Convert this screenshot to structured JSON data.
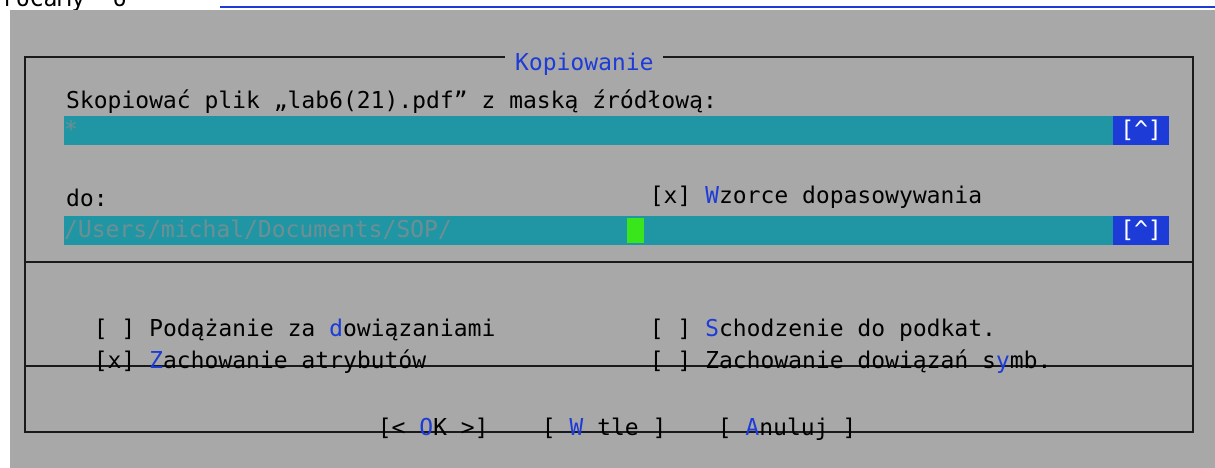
{
  "topbar": {
    "text": "roCaMy  o"
  },
  "dialog": {
    "title": "Kopiowanie",
    "source_label": "Skopiować plik „lab6(21).pdf” z maską źródłową:",
    "source_value": "*",
    "history_button": "[^]",
    "wildcard_option": {
      "check": "[x] ",
      "hotkey": "W",
      "rest": "zorce dopasowywania"
    },
    "dest_label": "do:",
    "dest_value": "/Users/michal/Documents/SOP/",
    "options": [
      {
        "check": "[ ] ",
        "pre": "Podążanie za ",
        "hotkey": "d",
        "post": "owiązaniami"
      },
      {
        "check": "[ ] ",
        "pre": "",
        "hotkey": "S",
        "post": "chodzenie do podkat."
      },
      {
        "check": "[x] ",
        "pre": "",
        "hotkey": "Z",
        "post": "achowanie atrybutów"
      },
      {
        "check": "[ ] ",
        "pre": "Zachowanie dowiązań s",
        "hotkey": "y",
        "post": "mb."
      }
    ],
    "buttons": [
      {
        "pre": "[< ",
        "hotkey": "O",
        "post": "K >]"
      },
      {
        "pre": "[ ",
        "hotkey": "W",
        "post": " tle ]"
      },
      {
        "pre": "[ ",
        "hotkey": "A",
        "post": "nuluj ]"
      }
    ]
  },
  "colors": {
    "background": "#a8a8a8",
    "input_field": "#2096a4",
    "hotkey": "#1d3bd6",
    "cursor": "#39e61b"
  }
}
